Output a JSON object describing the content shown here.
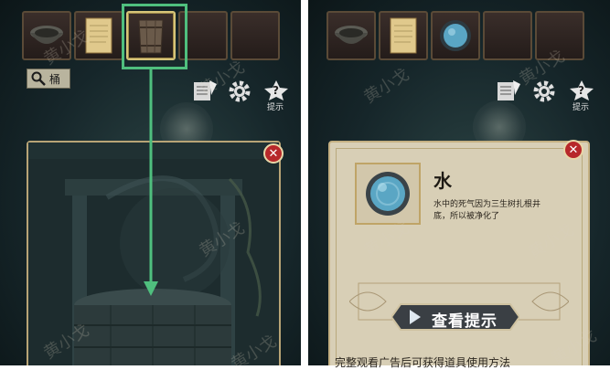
{
  "left_panel": {
    "inventory": [
      {
        "name": "stone-bowl"
      },
      {
        "name": "paper-scroll"
      },
      {
        "name": "wooden-bucket",
        "selected": true
      },
      {
        "name": "empty"
      },
      {
        "name": "empty"
      }
    ],
    "zoom_item_label": "桶",
    "hint_label": "提示"
  },
  "right_panel": {
    "inventory": [
      {
        "name": "stone-bowl"
      },
      {
        "name": "paper-scroll"
      },
      {
        "name": "water-orb"
      },
      {
        "name": "empty"
      },
      {
        "name": "empty"
      }
    ],
    "hint_label": "提示",
    "item": {
      "title": "水",
      "description": "水中的死气因为三生树扎根井底，所以被净化了",
      "hint_button": "查看提示",
      "bottom_note": "完整观看广告后可获得道具使用方法"
    }
  },
  "watermark": "黄小戈",
  "colors": {
    "selection_frame": "#4fbf7e",
    "arrow": "#4fbf7e",
    "close_button": "#b7282a",
    "parchment": "#d8cfb6",
    "water_orb": "#5aa6c4"
  }
}
